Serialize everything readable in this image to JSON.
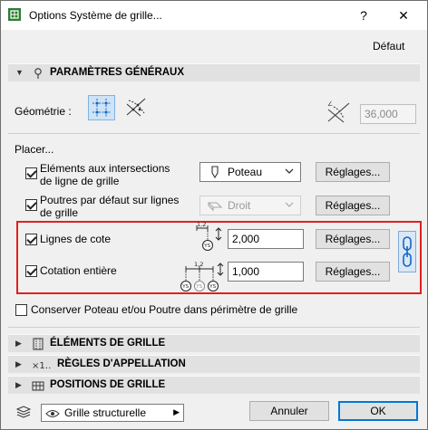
{
  "window": {
    "title": "Options Système de grille...",
    "help_label": "?",
    "close_label": "✕"
  },
  "header": {
    "default_label": "Défaut"
  },
  "sections": {
    "general": "PARAMÈTRES GÉNÉRAUX",
    "grid_elements": "ÉLÉMENTS DE GRILLE",
    "naming_rules": "RÈGLES D'APPELLATION",
    "grid_positions": "POSITIONS DE GRILLE"
  },
  "geometry": {
    "label": "Géométrie :",
    "angle_value": "36,000"
  },
  "place": {
    "label": "Placer...",
    "intersections": {
      "label_line1": "Eléments aux intersections",
      "label_line2": "de ligne de grille",
      "checked": true,
      "dropdown_value": "Poteau",
      "settings_label": "Réglages..."
    },
    "beams": {
      "label_line1": "Poutres par défaut sur lignes",
      "label_line2": "de grille",
      "checked": true,
      "dropdown_value": "Droit",
      "settings_label": "Réglages..."
    },
    "dimension_lines": {
      "label": "Lignes de cote",
      "checked": true,
      "value": "2,000",
      "settings_label": "Réglages...",
      "icon_text": "1,2"
    },
    "overall_dimension": {
      "label": "Cotation entière",
      "checked": true,
      "value": "1,000",
      "settings_label": "Réglages...",
      "icon_text": "1,2"
    }
  },
  "keep_option": {
    "label": "Conserver Poteau et/ou Poutre dans périmètre de grille",
    "checked": false
  },
  "footer": {
    "layer_value": "Grille structurelle",
    "cancel_label": "Annuler",
    "ok_label": "OK"
  },
  "colors": {
    "highlight_border": "#e02020",
    "accent_blue": "#0078d7",
    "section_bar": "#e1e1e1"
  }
}
